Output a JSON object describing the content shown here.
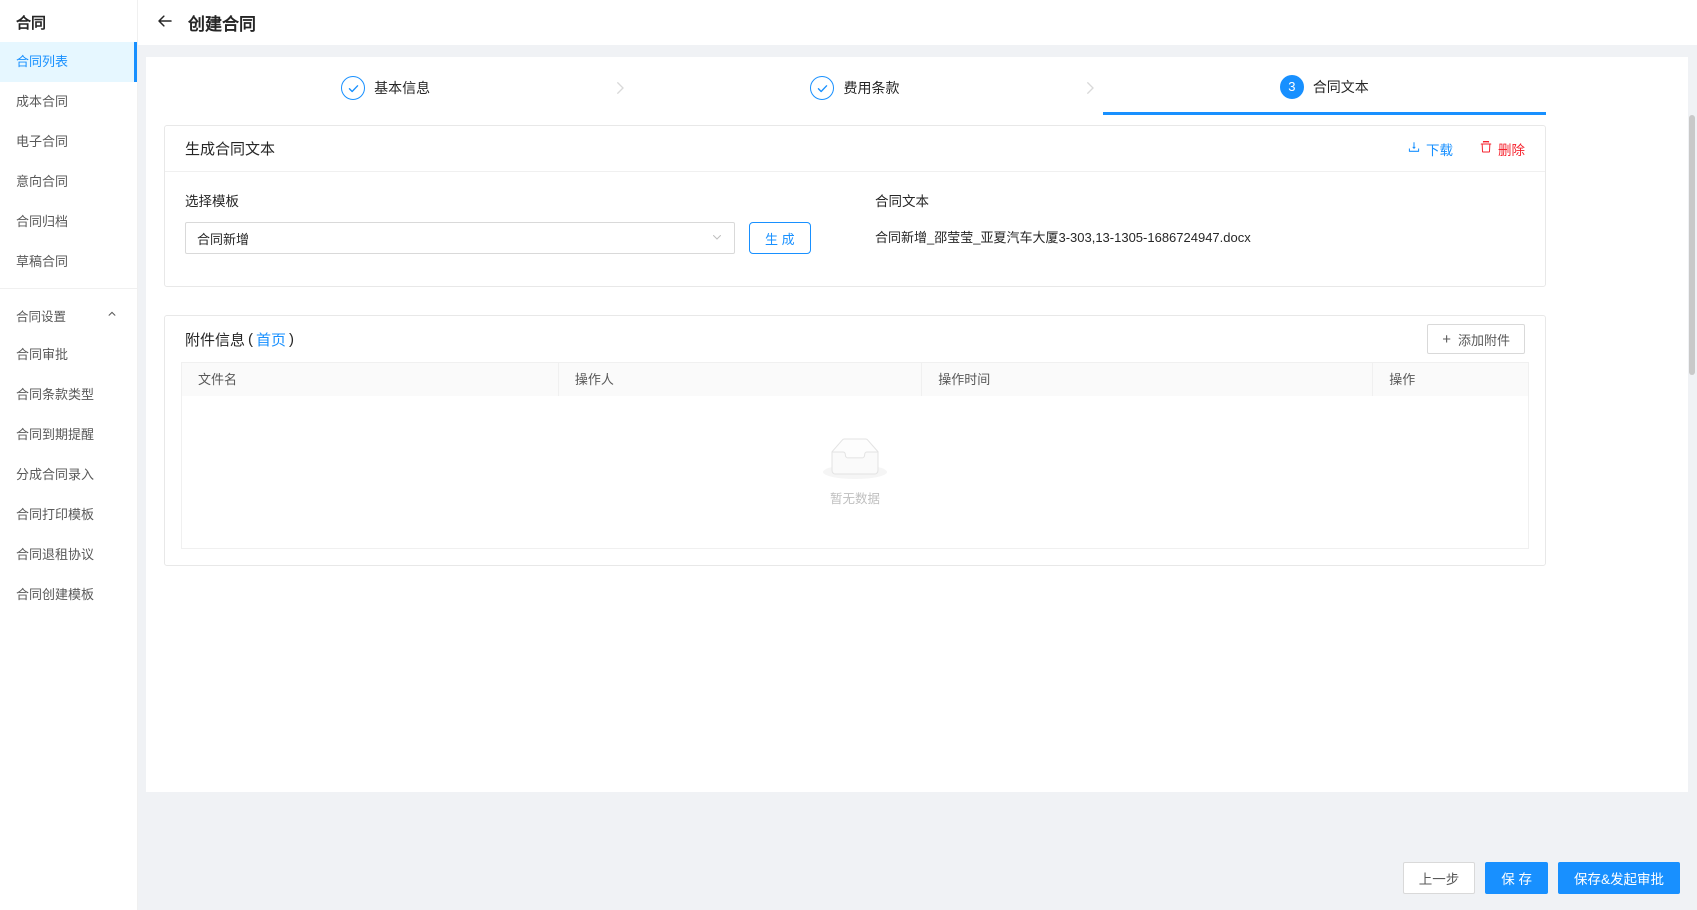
{
  "colors": {
    "primary": "#1890ff",
    "danger": "#f5222d",
    "active_bg": "#e6f7ff"
  },
  "sidebar": {
    "title": "合同",
    "items": [
      "合同列表",
      "成本合同",
      "电子合同",
      "意向合同",
      "合同归档",
      "草稿合同"
    ],
    "active_item": "合同列表",
    "group_label": "合同设置",
    "group_items": [
      "合同审批",
      "合同条款类型",
      "合同到期提醒",
      "分成合同录入",
      "合同打印模板",
      "合同退租协议",
      "合同创建模板"
    ]
  },
  "header": {
    "title": "创建合同"
  },
  "stepper": {
    "steps": [
      {
        "label": "基本信息",
        "state": "done"
      },
      {
        "label": "费用条款",
        "state": "done"
      },
      {
        "label": "合同文本",
        "state": "active",
        "number": "3"
      }
    ]
  },
  "generate_section": {
    "title": "生成合同文本",
    "download_label": "下载",
    "delete_label": "删除",
    "template_label": "选择模板",
    "template_value": "合同新增",
    "generate_label": "生 成",
    "text_label": "合同文本",
    "file_name": "合同新增_邵莹莹_亚夏汽车大厦3-303,13-1305-1686724947.docx"
  },
  "attachment_section": {
    "title": "附件信息",
    "paren_open": "(",
    "page_link": "首页",
    "paren_close": ")",
    "add_label": "添加附件",
    "columns": [
      "文件名",
      "操作人",
      "操作时间",
      "操作"
    ],
    "rows": [],
    "empty_text": "暂无数据"
  },
  "footer": {
    "prev_label": "上一步",
    "save_label": "保 存",
    "save_submit_label": "保存&发起审批"
  }
}
